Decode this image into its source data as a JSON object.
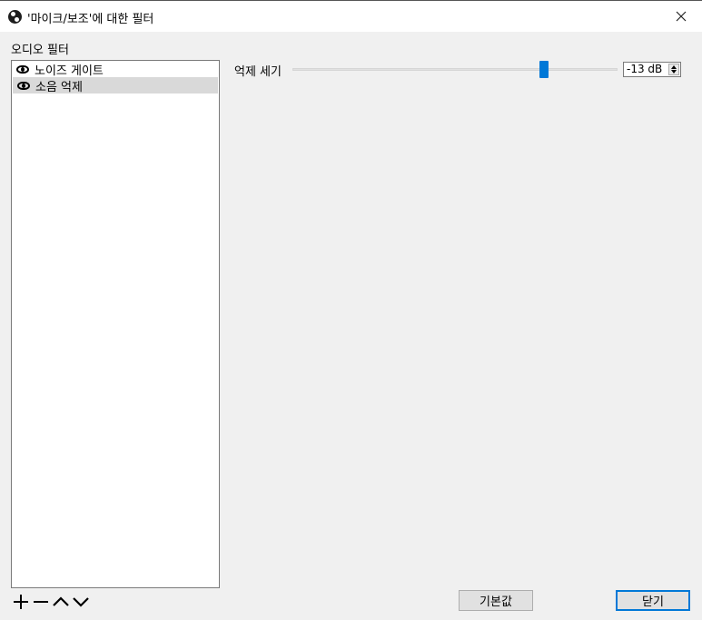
{
  "window": {
    "title": "'마이크/보조'에 대한 필터"
  },
  "filters": {
    "section_label": "오디오 필터",
    "items": [
      {
        "label": "노이즈 게이트",
        "visible": true,
        "selected": false
      },
      {
        "label": "소음 억제",
        "visible": true,
        "selected": true
      }
    ]
  },
  "settings": {
    "suppression_label": "억제 세기",
    "suppression_value": "-13 dB",
    "slider_level_db": -13
  },
  "buttons": {
    "defaults_label": "기본값",
    "close_label": "닫기"
  },
  "icons": {
    "app": "obs-logo-icon",
    "close": "close-icon",
    "visibility": "eye-icon",
    "add": "plus-icon",
    "remove": "minus-icon",
    "move_up": "chevron-up-icon",
    "move_down": "chevron-down-icon"
  },
  "colors": {
    "accent": "#0078d7",
    "selected_row": "#d9d9d9",
    "window_bg": "#f0f0f0"
  }
}
